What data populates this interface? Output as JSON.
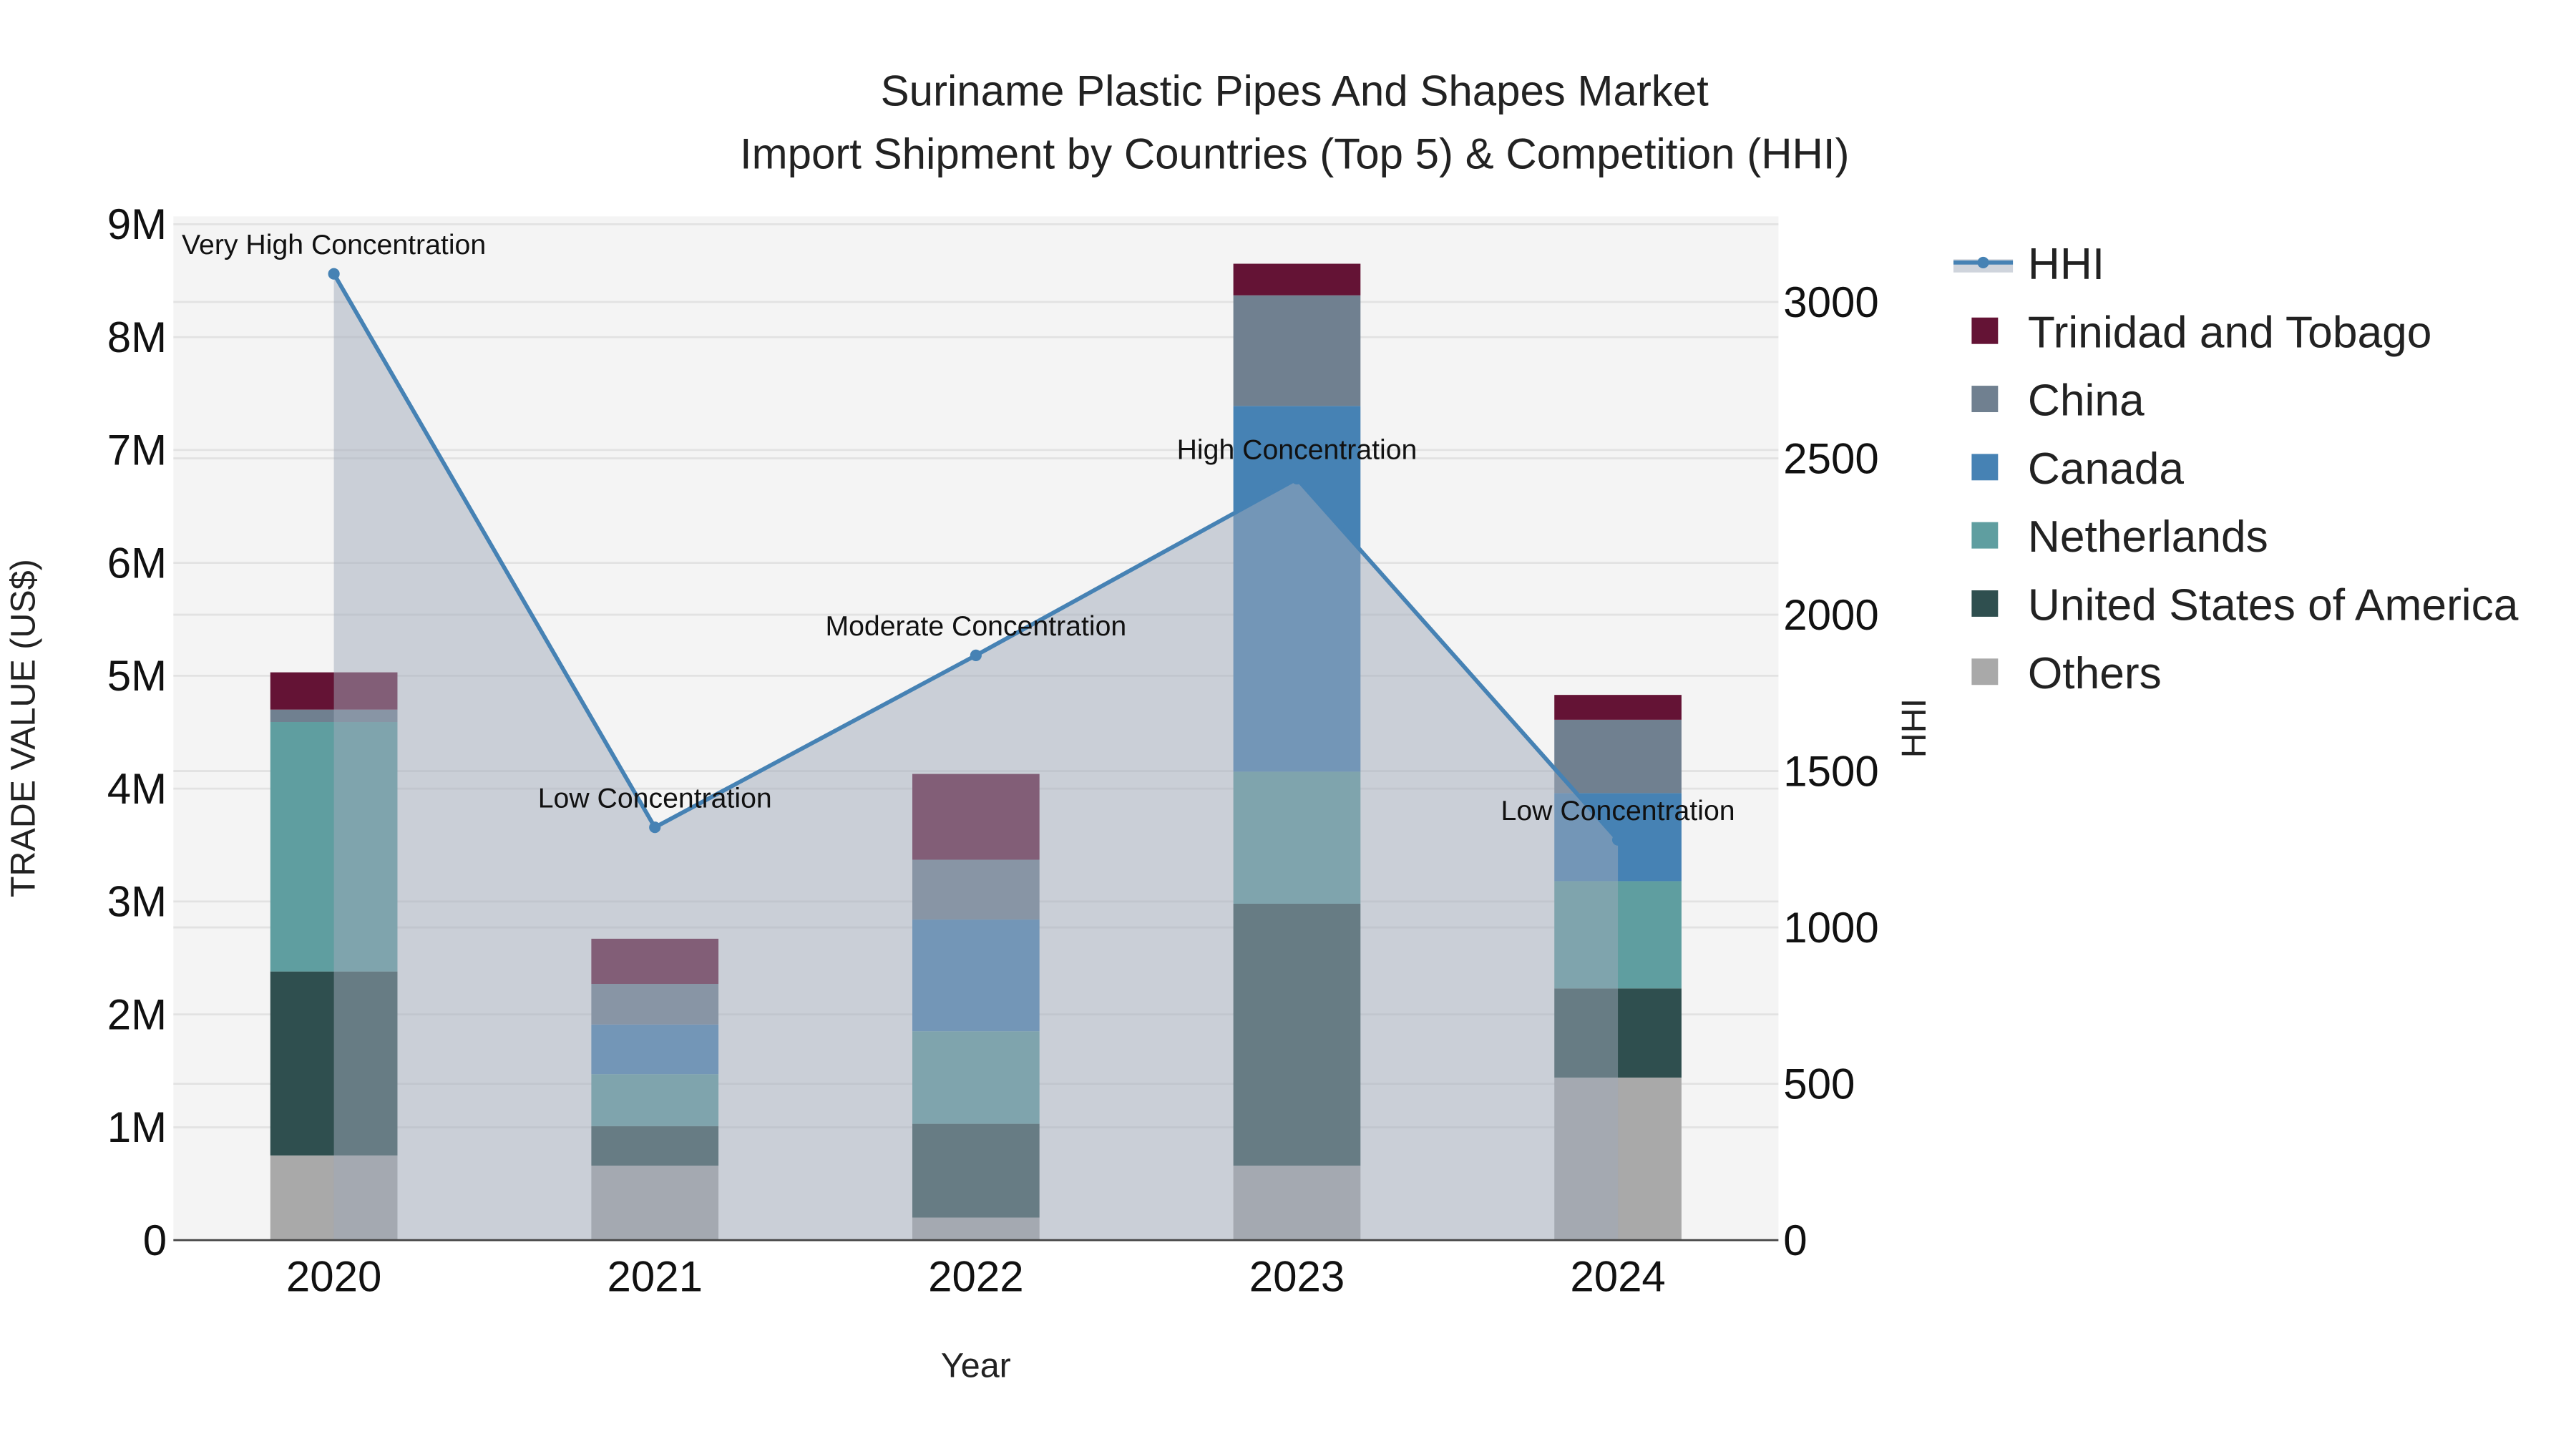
{
  "chart_data": {
    "type": "bar",
    "stacked": true,
    "title": "Suriname Plastic Pipes And Shapes Market",
    "subtitle": "Import Shipment by Countries (Top 5) & Competition (HHI)",
    "xlabel": "Year",
    "ylabel": "TRADE VALUE (US$)",
    "y2label": "HHI",
    "categories": [
      "2020",
      "2021",
      "2022",
      "2023",
      "2024"
    ],
    "ylim": [
      0,
      9070000
    ],
    "y2lim": [
      0,
      3274
    ],
    "yticks": [
      0,
      1000000,
      2000000,
      3000000,
      4000000,
      5000000,
      6000000,
      7000000,
      8000000,
      9000000
    ],
    "ytick_labels": [
      "0",
      "1M",
      "2M",
      "3M",
      "4M",
      "5M",
      "6M",
      "7M",
      "8M",
      "9M"
    ],
    "y2ticks": [
      0,
      500,
      1000,
      1500,
      2000,
      2500,
      3000
    ],
    "y2tick_labels": [
      "0",
      "500",
      "1000",
      "1500",
      "2000",
      "2500",
      "3000"
    ],
    "grid": true,
    "legend_placement": "right",
    "series": [
      {
        "name": "Others",
        "color": "#a9a9a9",
        "values": [
          750000,
          660000,
          200000,
          660000,
          1440000
        ]
      },
      {
        "name": "United States of America",
        "color": "#2f4f4f",
        "values": [
          1630000,
          350000,
          830000,
          2320000,
          790000
        ]
      },
      {
        "name": "Netherlands",
        "color": "#5f9ea0",
        "values": [
          2210000,
          460000,
          820000,
          1170000,
          950000
        ]
      },
      {
        "name": "Canada",
        "color": "#4682b4",
        "values": [
          0,
          440000,
          990000,
          3240000,
          780000
        ]
      },
      {
        "name": "China",
        "color": "#708090",
        "values": [
          110000,
          360000,
          530000,
          980000,
          650000
        ]
      },
      {
        "name": "Trinidad and Tobago",
        "color": "#641335",
        "values": [
          330000,
          400000,
          760000,
          280000,
          220000
        ]
      }
    ],
    "hhi": {
      "name": "HHI",
      "color": "#4682b4",
      "values": [
        3090,
        1320,
        1870,
        2435,
        1280
      ],
      "annotations": [
        "Very High Concentration",
        "Low Concentration",
        "Moderate Concentration",
        "High Concentration",
        "Low Concentration"
      ]
    },
    "legend": [
      "HHI",
      "Trinidad and Tobago",
      "China",
      "Canada",
      "Netherlands",
      "United States of America",
      "Others"
    ]
  }
}
